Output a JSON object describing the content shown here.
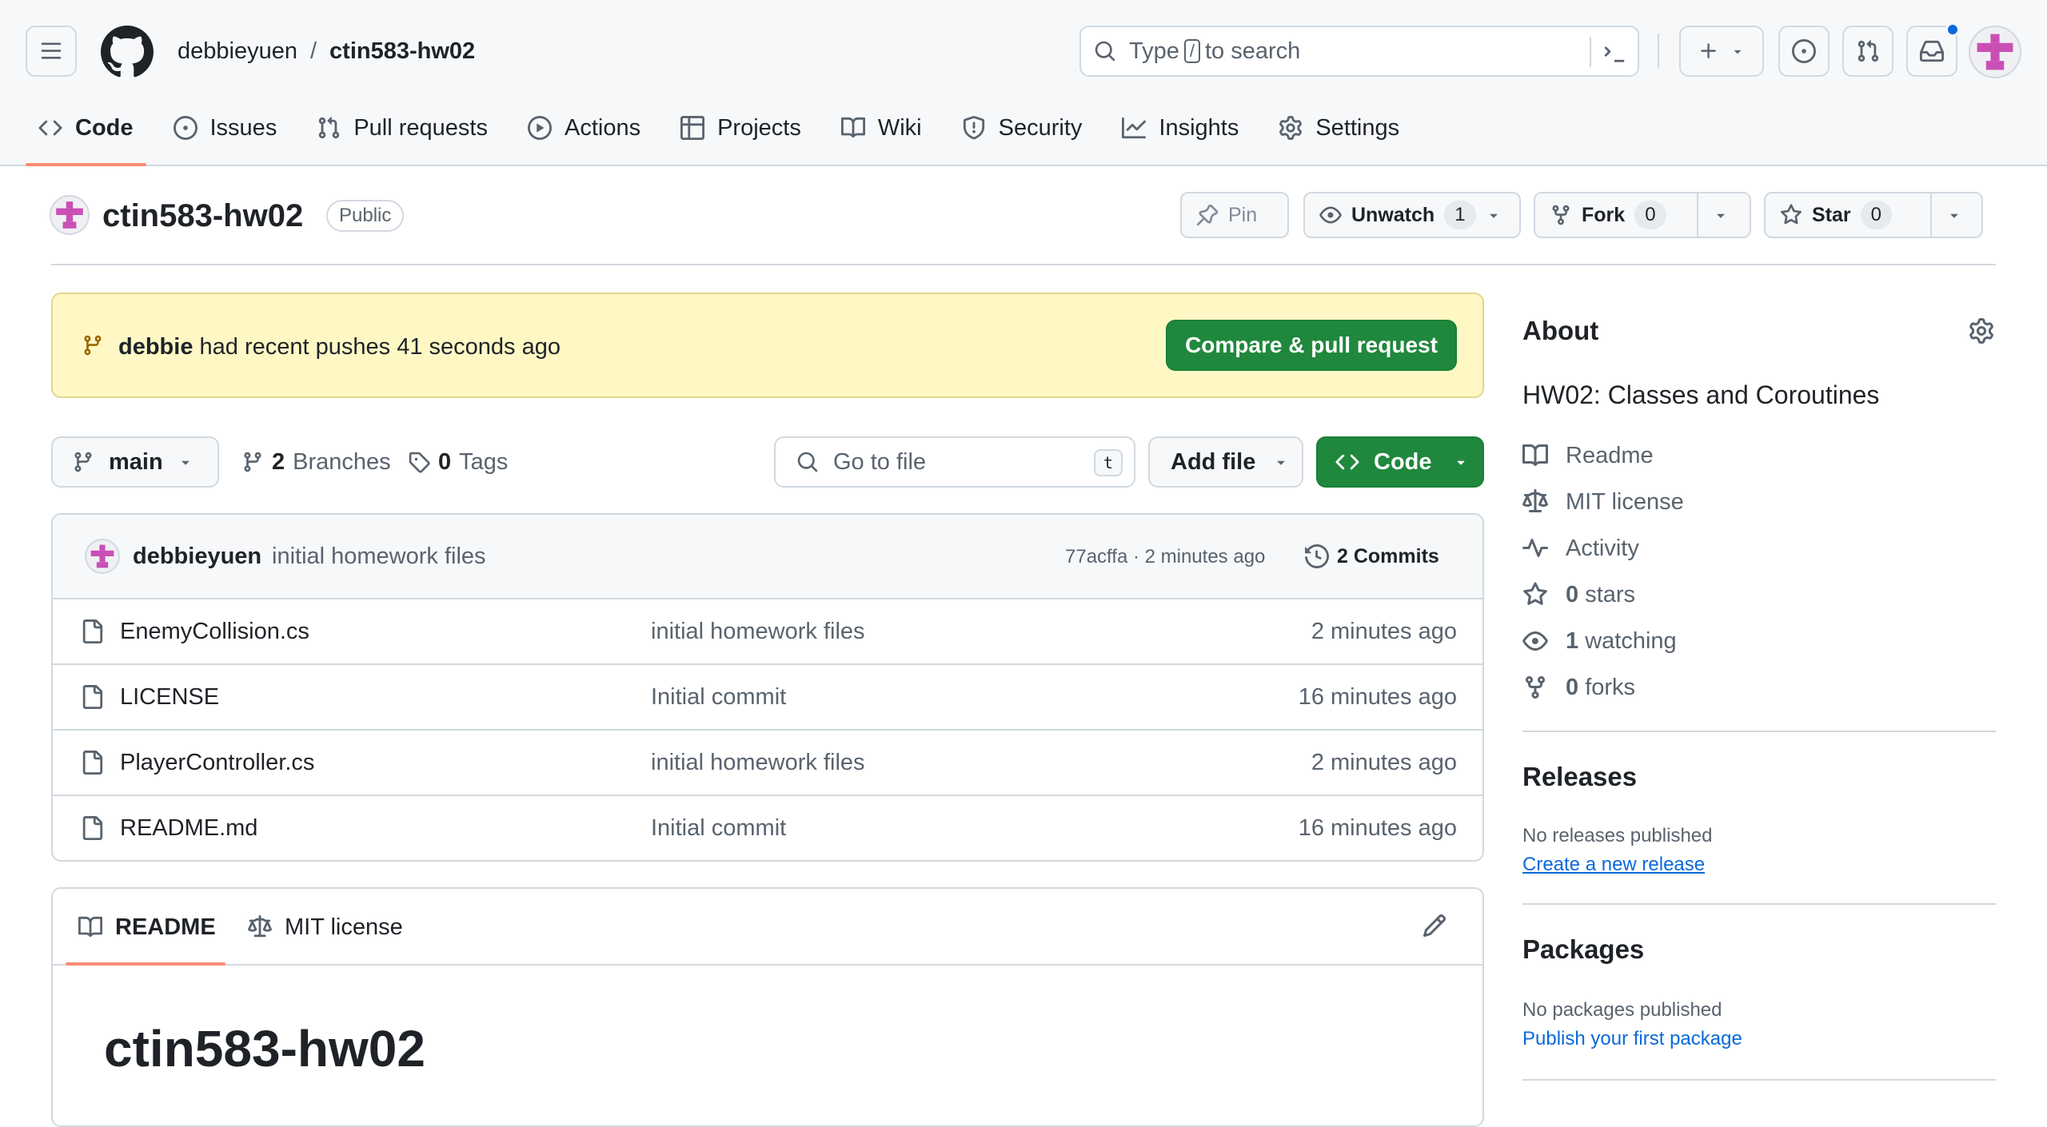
{
  "header": {
    "owner": "debbieyuen",
    "separator": "/",
    "repo": "ctin583-hw02",
    "search": {
      "prefix": "Type",
      "key": "/",
      "suffix": "to search"
    }
  },
  "tabs": [
    {
      "label": "Code",
      "icon": "code-icon",
      "active": true
    },
    {
      "label": "Issues",
      "icon": "issue-icon"
    },
    {
      "label": "Pull requests",
      "icon": "pull-request-icon"
    },
    {
      "label": "Actions",
      "icon": "play-icon"
    },
    {
      "label": "Projects",
      "icon": "table-icon"
    },
    {
      "label": "Wiki",
      "icon": "book-icon"
    },
    {
      "label": "Security",
      "icon": "shield-icon"
    },
    {
      "label": "Insights",
      "icon": "graph-icon"
    },
    {
      "label": "Settings",
      "icon": "gear-icon"
    }
  ],
  "repo": {
    "name": "ctin583-hw02",
    "visibility": "Public",
    "pin_label": "Pin",
    "watch_label": "Unwatch",
    "watch_count": "1",
    "fork_label": "Fork",
    "fork_count": "0",
    "star_label": "Star",
    "star_count": "0"
  },
  "flash": {
    "user": "debbie",
    "text": "had recent pushes 41 seconds ago",
    "button": "Compare & pull request",
    "bg_color": "#fff8c5"
  },
  "file_nav": {
    "branch": "main",
    "branches_count": "2",
    "branches_label": "Branches",
    "tags_count": "0",
    "tags_label": "Tags",
    "goto_placeholder": "Go to file",
    "goto_key": "t",
    "add_file": "Add file",
    "code_button": "Code"
  },
  "latest_commit": {
    "author": "debbieyuen",
    "message": "initial homework files",
    "hash_time": "77acffa · 2 minutes ago",
    "commits_label": "2 Commits"
  },
  "files": [
    {
      "name": "EnemyCollision.cs",
      "message": "initial homework files",
      "time": "2 minutes ago"
    },
    {
      "name": "LICENSE",
      "message": "Initial commit",
      "time": "16 minutes ago"
    },
    {
      "name": "PlayerController.cs",
      "message": "initial homework files",
      "time": "2 minutes ago"
    },
    {
      "name": "README.md",
      "message": "Initial commit",
      "time": "16 minutes ago"
    }
  ],
  "readme": {
    "tab_readme": "README",
    "tab_license": "MIT license",
    "heading": "ctin583-hw02"
  },
  "about": {
    "title": "About",
    "description": "HW02: Classes and Coroutines",
    "readme": "Readme",
    "license": "MIT license",
    "activity": "Activity",
    "stars_count": "0",
    "stars_label": "stars",
    "watching_count": "1",
    "watching_label": "watching",
    "forks_count": "0",
    "forks_label": "forks"
  },
  "releases": {
    "title": "Releases",
    "note": "No releases published",
    "link": "Create a new release"
  },
  "packages": {
    "title": "Packages",
    "note": "No packages published",
    "link": "Publish your first package"
  },
  "colors": {
    "accent_green": "#1f883d",
    "tab_underline": "#fd8c73",
    "link_blue": "#0969da",
    "notification_dot": "#0969da",
    "avatar_magenta": "#c94fb5"
  }
}
